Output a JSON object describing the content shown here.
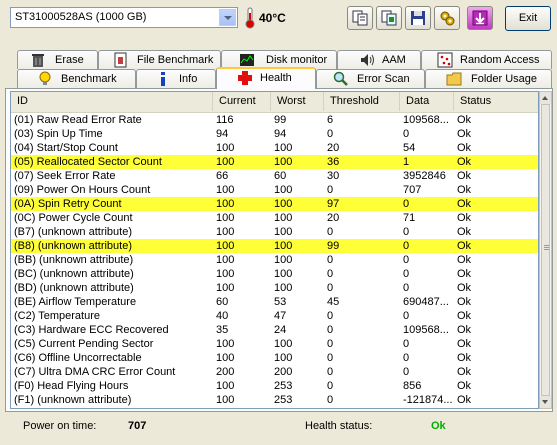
{
  "toolbar": {
    "drive": "ST31000528AS (1000 GB)",
    "temperature": "40°C",
    "exit_label": "Exit"
  },
  "tabs_top": [
    "Erase",
    "File Benchmark",
    "Disk monitor",
    "AAM",
    "Random Access"
  ],
  "tabs_bottom": [
    "Benchmark",
    "Info",
    "Health",
    "Error Scan",
    "Folder Usage"
  ],
  "active_tab": "Health",
  "table": {
    "columns": [
      "ID",
      "Current",
      "Worst",
      "Threshold",
      "Data",
      "Status"
    ],
    "rows": [
      [
        "(01) Raw Read Error Rate",
        "116",
        "99",
        "6",
        "109568...",
        "Ok"
      ],
      [
        "(03) Spin Up Time",
        "94",
        "94",
        "0",
        "0",
        "Ok"
      ],
      [
        "(04) Start/Stop Count",
        "100",
        "100",
        "20",
        "54",
        "Ok"
      ],
      [
        "(05) Reallocated Sector Count",
        "100",
        "100",
        "36",
        "1",
        "Ok"
      ],
      [
        "(07) Seek Error Rate",
        "66",
        "60",
        "30",
        "3952846",
        "Ok"
      ],
      [
        "(09) Power On Hours Count",
        "100",
        "100",
        "0",
        "707",
        "Ok"
      ],
      [
        "(0A) Spin Retry Count",
        "100",
        "100",
        "97",
        "0",
        "Ok"
      ],
      [
        "(0C) Power Cycle Count",
        "100",
        "100",
        "20",
        "71",
        "Ok"
      ],
      [
        "(B7) (unknown attribute)",
        "100",
        "100",
        "0",
        "0",
        "Ok"
      ],
      [
        "(B8) (unknown attribute)",
        "100",
        "100",
        "99",
        "0",
        "Ok"
      ],
      [
        "(BB) (unknown attribute)",
        "100",
        "100",
        "0",
        "0",
        "Ok"
      ],
      [
        "(BC) (unknown attribute)",
        "100",
        "100",
        "0",
        "0",
        "Ok"
      ],
      [
        "(BD) (unknown attribute)",
        "100",
        "100",
        "0",
        "0",
        "Ok"
      ],
      [
        "(BE) Airflow Temperature",
        "60",
        "53",
        "45",
        "690487...",
        "Ok"
      ],
      [
        "(C2) Temperature",
        "40",
        "47",
        "0",
        "0",
        "Ok"
      ],
      [
        "(C3) Hardware ECC Recovered",
        "35",
        "24",
        "0",
        "109568...",
        "Ok"
      ],
      [
        "(C5) Current Pending Sector",
        "100",
        "100",
        "0",
        "0",
        "Ok"
      ],
      [
        "(C6) Offline Uncorrectable",
        "100",
        "100",
        "0",
        "0",
        "Ok"
      ],
      [
        "(C7) Ultra DMA CRC Error Count",
        "200",
        "200",
        "0",
        "0",
        "Ok"
      ],
      [
        "(F0) Head Flying Hours",
        "100",
        "253",
        "0",
        "856",
        "Ok"
      ],
      [
        "(F1) (unknown attribute)",
        "100",
        "253",
        "0",
        "-121874...",
        "Ok"
      ]
    ],
    "highlighted_rows": [
      3,
      6,
      9
    ],
    "highlight_color": "#ffff38"
  },
  "footer": {
    "power_on_label": "Power on time:",
    "power_on_value": "707",
    "health_label": "Health status:",
    "health_value": "Ok",
    "health_color": "#00b000"
  }
}
